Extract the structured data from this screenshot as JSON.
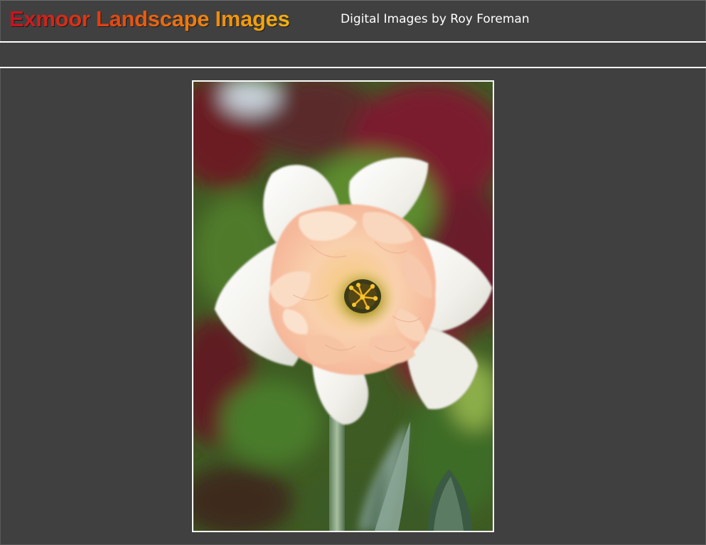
{
  "header": {
    "site_title": "Exmoor Landscape Images",
    "subtitle": "Digital Images by Roy Foreman"
  },
  "photo": {
    "subject": "flower-photo"
  },
  "colors": {
    "background": "#404040",
    "title_gradient_start": "#c6121f",
    "title_gradient_end": "#f4b10e",
    "rule": "#ffffff",
    "subtitle_text": "#ffffff"
  }
}
